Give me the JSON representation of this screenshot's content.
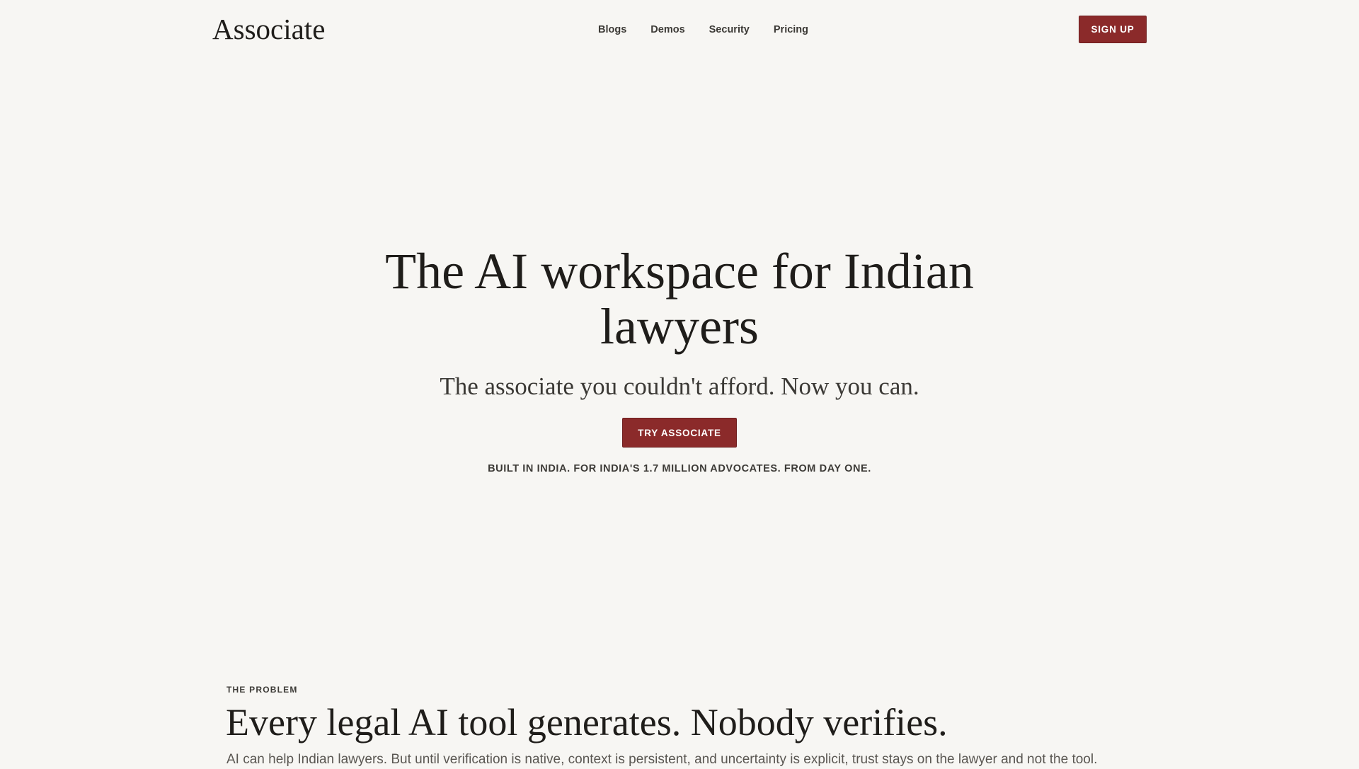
{
  "header": {
    "brand": "Associate",
    "nav": [
      "Blogs",
      "Demos",
      "Security",
      "Pricing"
    ],
    "signup_label": "SIGN UP"
  },
  "hero": {
    "title": "The AI workspace for Indian lawyers",
    "subtitle": "The associate you couldn't afford. Now you can.",
    "cta_label": "TRY ASSOCIATE",
    "tagline": "BUILT IN INDIA. FOR INDIA'S 1.7 MILLION ADVOCATES. FROM DAY ONE."
  },
  "problem": {
    "eyebrow": "THE PROBLEM",
    "title": "Every legal AI tool generates. Nobody verifies.",
    "body": "AI can help Indian lawyers. But until verification is native, context is persistent, and uncertainty is explicit, trust stays on the lawyer and not the tool."
  },
  "colors": {
    "background": "#f7f6f3",
    "accent": "#8b2a2a",
    "text": "#1f1d1a"
  }
}
